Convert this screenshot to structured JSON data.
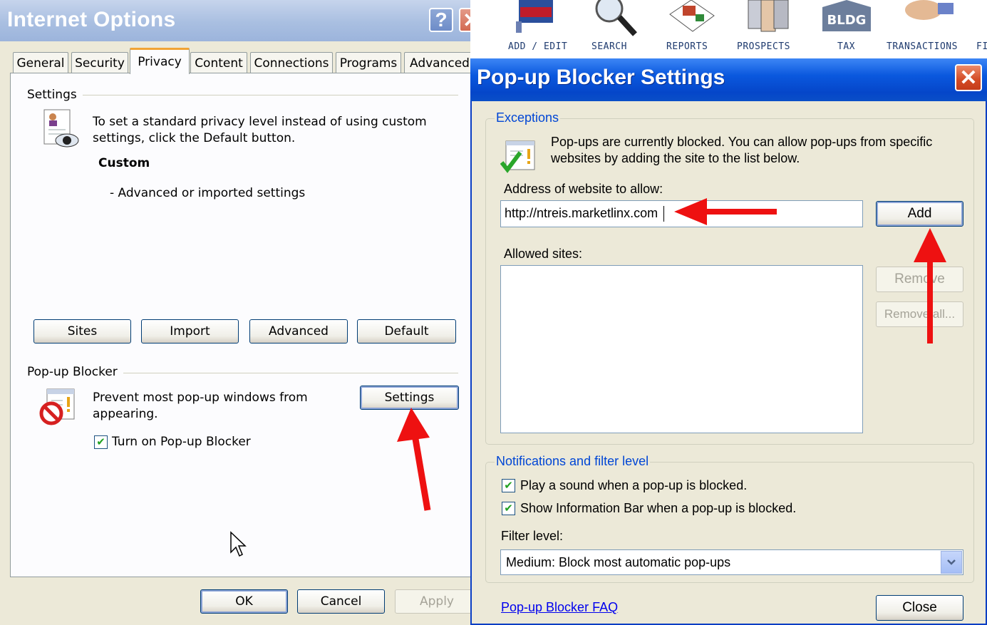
{
  "internet_options": {
    "title": "Internet Options",
    "tabs": [
      "General",
      "Security",
      "Privacy",
      "Content",
      "Connections",
      "Programs",
      "Advanced"
    ],
    "active_tab": "Privacy",
    "settings": {
      "group_label": "Settings",
      "description": "To set a standard privacy level instead of using custom settings, click the Default button.",
      "level_name": "Custom",
      "level_detail": "- Advanced or imported settings",
      "buttons": {
        "sites": "Sites",
        "import": "Import",
        "advanced": "Advanced",
        "default": "Default"
      }
    },
    "popup_blocker": {
      "group_label": "Pop-up Blocker",
      "description": "Prevent most pop-up windows from appearing.",
      "settings_button": "Settings",
      "checkbox_label": "Turn on Pop-up Blocker",
      "checkbox_checked": true
    },
    "footer": {
      "ok": "OK",
      "cancel": "Cancel",
      "apply": "Apply"
    }
  },
  "toolbar": {
    "items": [
      "ADD / EDIT",
      "SEARCH",
      "REPORTS",
      "PROSPECTS",
      "TAX",
      "TRANSACTIONS",
      "FI"
    ]
  },
  "popup_settings": {
    "title": "Pop-up Blocker Settings",
    "exceptions": {
      "legend": "Exceptions",
      "description": "Pop-ups are currently blocked.  You can allow pop-ups from specific websites by adding the site to the list below.",
      "address_label": "Address of website to allow:",
      "address_value": "http://ntreis.marketlinx.com",
      "add_button": "Add",
      "allowed_label": "Allowed sites:",
      "allowed_sites": [],
      "remove_button": "Remove",
      "remove_all_button": "Remove all..."
    },
    "notifications": {
      "legend": "Notifications and filter level",
      "play_sound": "Play a sound when a pop-up is blocked.",
      "play_sound_checked": true,
      "show_info_bar": "Show Information Bar when a pop-up is blocked.",
      "show_info_bar_checked": true,
      "filter_label": "Filter level:",
      "filter_value": "Medium: Block most automatic pop-ups"
    },
    "faq_link": "Pop-up Blocker FAQ",
    "close_button": "Close"
  },
  "colors": {
    "xp_blue_title": "#0a58de",
    "arrow_red": "#ee1111",
    "link_blue": "#0000ee",
    "dialog_bg": "#ece9d8"
  }
}
